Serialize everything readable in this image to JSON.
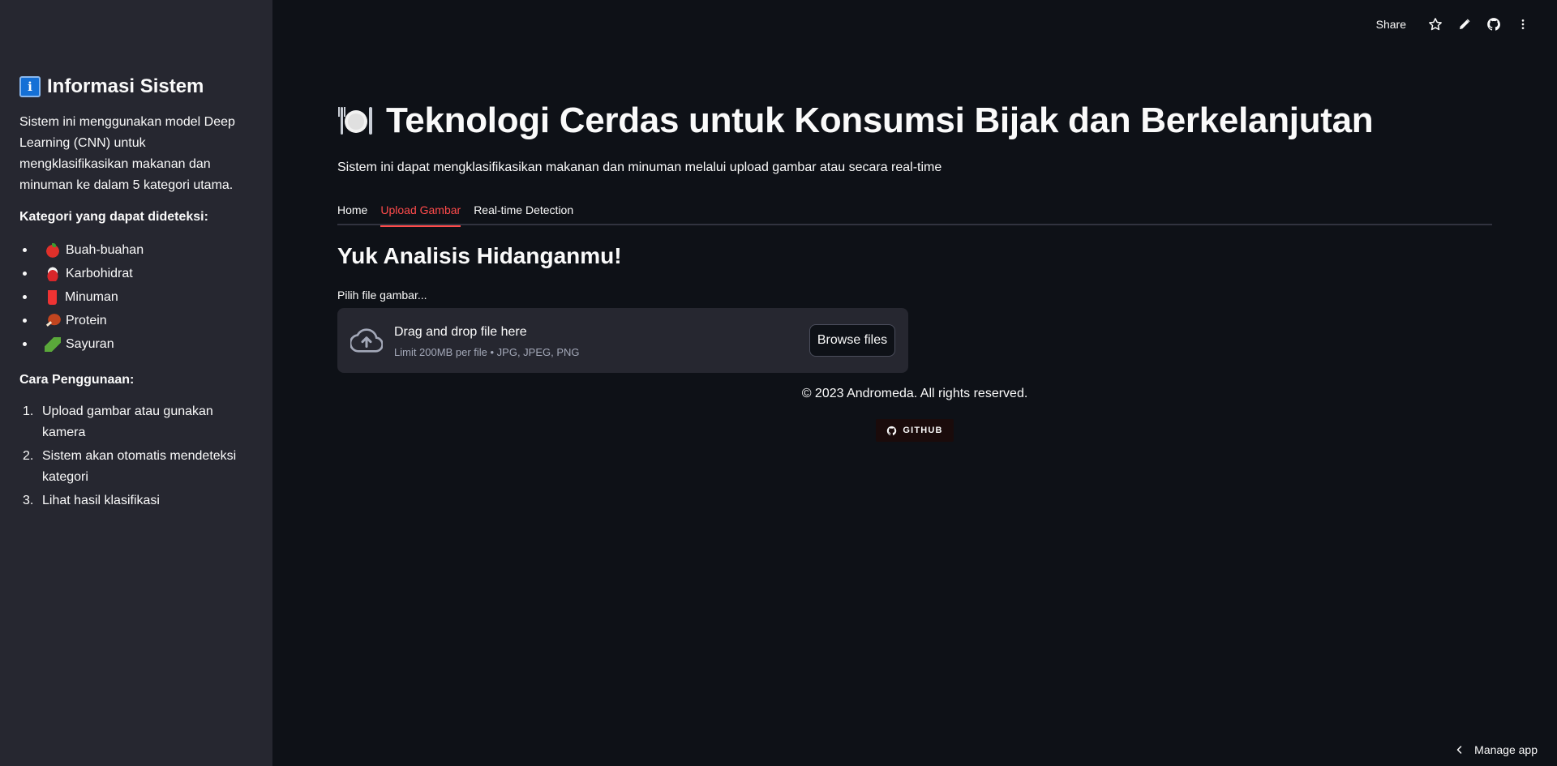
{
  "sidebar": {
    "title": "Informasi Sistem",
    "title_icon": "information-icon",
    "description": "Sistem ini menggunakan model Deep Learning (CNN) untuk mengklasifikasikan makanan dan minuman ke dalam 5 kategori utama.",
    "categories_heading": "Kategori yang dapat dideteksi:",
    "categories": [
      {
        "icon": "apple-icon",
        "label": "Buah-buahan"
      },
      {
        "icon": "rice-bowl-icon",
        "label": "Karbohidrat"
      },
      {
        "icon": "cup-icon",
        "label": "Minuman"
      },
      {
        "icon": "meat-icon",
        "label": "Protein"
      },
      {
        "icon": "cucumber-icon",
        "label": "Sayuran"
      }
    ],
    "usage_heading": "Cara Penggunaan:",
    "usage_steps": [
      {
        "num": "1.",
        "text": "Upload gambar atau gunakan kamera"
      },
      {
        "num": "2.",
        "text": "Sistem akan otomatis mendeteksi kategori"
      },
      {
        "num": "3.",
        "text": "Lihat hasil klasifikasi"
      }
    ]
  },
  "toolbar": {
    "share_label": "Share",
    "icons": [
      "star-icon",
      "pencil-icon",
      "github-icon",
      "more-vertical-icon"
    ]
  },
  "main": {
    "title": "Teknologi Cerdas untuk Konsumsi Bijak dan Berkelanjutan",
    "title_icon": "plate-cutlery-icon",
    "subtitle": "Sistem ini dapat mengklasifikasikan makanan dan minuman melalui upload gambar atau secara real-time",
    "tabs": [
      {
        "label": "Home",
        "active": false
      },
      {
        "label": "Upload Gambar",
        "active": true
      },
      {
        "label": "Real-time Detection",
        "active": false
      }
    ],
    "section_title": "Yuk Analisis Hidanganmu!",
    "uploader": {
      "label": "Pilih file gambar...",
      "drop_text": "Drag and drop file here",
      "limit_text": "Limit 200MB per file • JPG, JPEG, PNG",
      "browse_label": "Browse files"
    },
    "footer": "© 2023 Andromeda. All rights reserved.",
    "github_badge": "GITHUB"
  },
  "manage_app": "Manage app",
  "colors": {
    "background": "#0e1117",
    "sidebar": "#262730",
    "accent": "#ff4b4b",
    "text": "#fafafa"
  }
}
